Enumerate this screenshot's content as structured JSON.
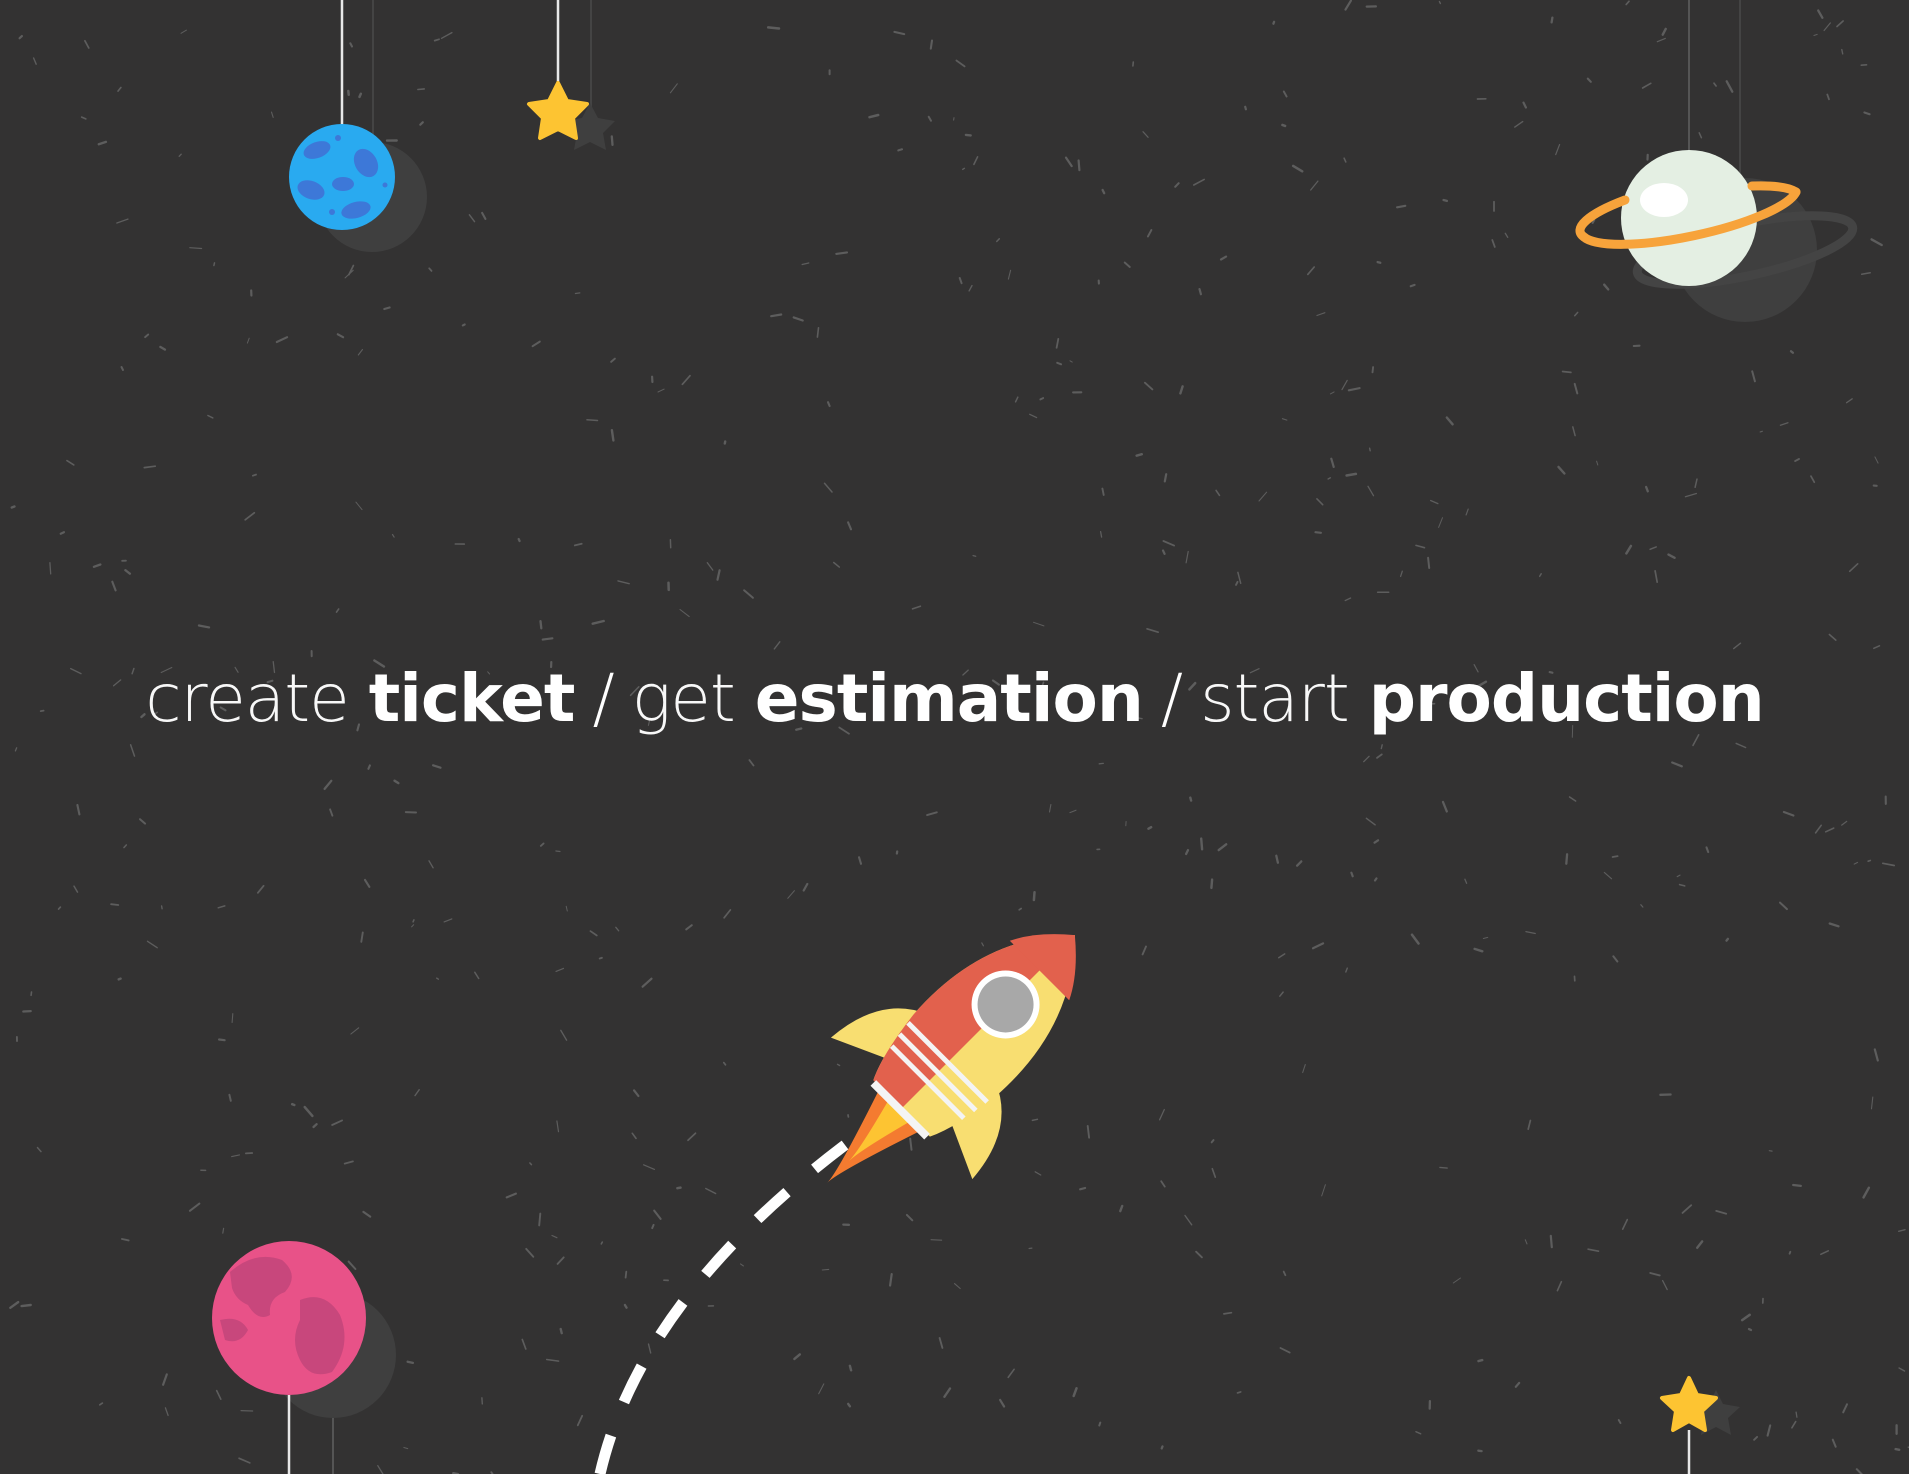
{
  "colors": {
    "background": "#333232",
    "speck": "#5d5d5d",
    "shadow": "#3f3f3f",
    "string": "#e8e8e8",
    "blue_planet": "#29aaf0",
    "blue_crater": "#3d78d8",
    "star": "#fdc432",
    "saturn_body": "#e4efe3",
    "saturn_ring": "#f7a33b",
    "pink_planet": "#e85288",
    "pink_continent": "#c8477c",
    "rocket_body": "#f8de71",
    "rocket_red": "#e2614d",
    "rocket_window": "#a8a8a8",
    "flame_outer": "#f47b30",
    "flame_inner": "#fdc432",
    "trail": "#ffffff"
  },
  "icons": [
    "blue-planet-icon",
    "star-icon",
    "saturn-icon",
    "pink-planet-icon",
    "rocket-icon"
  ],
  "tagline": {
    "part1_light": "create ",
    "part1_bold": "ticket",
    "sep1": "/",
    "part2_light": "get ",
    "part2_bold": "estimation",
    "sep2": "/",
    "part3_light": "start ",
    "part3_bold": "production"
  }
}
